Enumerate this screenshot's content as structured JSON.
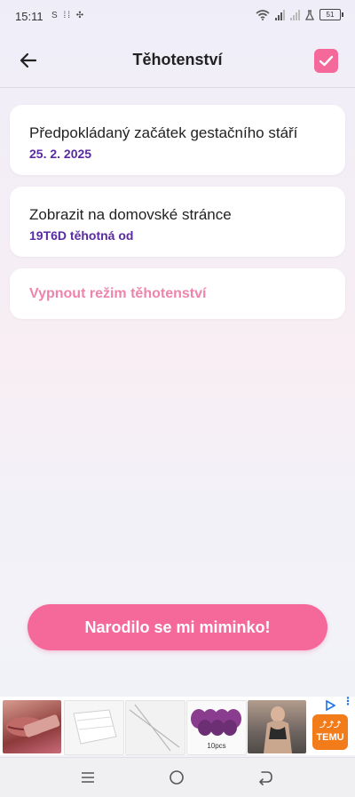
{
  "status": {
    "time": "15:11",
    "left_icons": "S ⁞⁞ ✣",
    "battery": "51"
  },
  "header": {
    "title": "Těhotenství"
  },
  "settings": {
    "due_label": "Předpokládaný začátek gestačního stáří",
    "due_value": "25. 2. 2025",
    "home_label": "Zobrazit na domovské stránce",
    "home_value": "19T6D těhotná od",
    "disable_label": "Vypnout režim těhotenství"
  },
  "cta": {
    "label": "Narodilo se mi miminko!"
  },
  "ad": {
    "tile4_caption": "10pcs",
    "brand_top": "⤴︎⤴︎⤴︎",
    "brand": "TEMU"
  },
  "colors": {
    "accent": "#f4689a",
    "secondary_text": "#5a2aa0",
    "danger_text": "#ee84ac"
  },
  "icons": {
    "back": "arrow-left-icon",
    "confirm": "checkmark-icon",
    "nav_menu": "menu-icon",
    "nav_home": "home-circle-icon",
    "nav_back": "back-arrow-icon"
  }
}
